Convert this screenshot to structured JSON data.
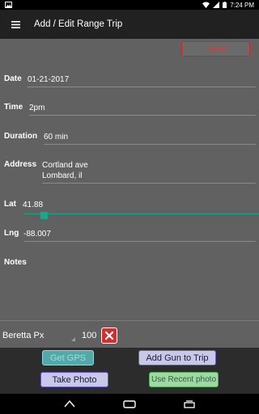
{
  "status_bar": {
    "time": "7:24 PM"
  },
  "toolbar": {
    "title": "Add / Edit Range Trip",
    "menu_icon": "hamburger-menu-icon"
  },
  "save_label": "Save",
  "form": {
    "date_label": "Date",
    "date_value": "01-21-2017",
    "time_label": "Time",
    "time_value": "2pm",
    "duration_label": "Duration",
    "duration_value": "60 min",
    "address_label": "Address",
    "address_value": "Cortland ave\nLombard, il",
    "lat_label": "Lat",
    "lat_value": "41.88",
    "lng_label": "Lng",
    "lng_value": "-88.007",
    "notes_label": "Notes",
    "notes_value": ""
  },
  "gun_row": {
    "name": "Beretta Px",
    "count": "100"
  },
  "buttons": {
    "get_gps": "Get GPS",
    "add_gun": "Add Gun to Trip",
    "take_photo": "Take Photo",
    "use_recent_photo": "Use Recent photo"
  },
  "colors": {
    "accent": "#1fa58a",
    "save_text": "#e53935",
    "remove": "#d32f2f"
  }
}
